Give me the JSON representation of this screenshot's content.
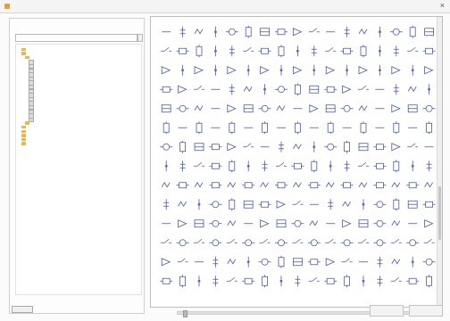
{
  "window": {
    "title": "",
    "close_glyph": "×",
    "icon": "app-icon"
  },
  "left_panel": {
    "filter_label": "",
    "filter_value": "",
    "tree": [
      {
        "indent": 1,
        "type": "folder",
        "label": ""
      },
      {
        "indent": 1,
        "type": "folder",
        "label": ""
      },
      {
        "indent": 2,
        "type": "folder",
        "label": "",
        "selected": true
      },
      {
        "indent": 3,
        "type": "file",
        "label": ""
      },
      {
        "indent": 3,
        "type": "file",
        "label": ""
      },
      {
        "indent": 3,
        "type": "file",
        "label": ""
      },
      {
        "indent": 3,
        "type": "file",
        "label": ""
      },
      {
        "indent": 3,
        "type": "file",
        "label": ""
      },
      {
        "indent": 3,
        "type": "file",
        "label": ""
      },
      {
        "indent": 3,
        "type": "file",
        "label": ""
      },
      {
        "indent": 3,
        "type": "file",
        "label": ""
      },
      {
        "indent": 3,
        "type": "file",
        "label": ""
      },
      {
        "indent": 3,
        "type": "file",
        "label": ""
      },
      {
        "indent": 3,
        "type": "file",
        "label": ""
      },
      {
        "indent": 3,
        "type": "file",
        "label": ""
      },
      {
        "indent": 3,
        "type": "file",
        "label": ""
      },
      {
        "indent": 3,
        "type": "file",
        "label": ""
      },
      {
        "indent": 3,
        "type": "file",
        "label": ""
      },
      {
        "indent": 2,
        "type": "folder",
        "label": ""
      },
      {
        "indent": 1,
        "type": "folder",
        "label": ""
      },
      {
        "indent": 1,
        "type": "folder",
        "label": ""
      },
      {
        "indent": 1,
        "type": "folder",
        "label": ""
      },
      {
        "indent": 1,
        "type": "folder",
        "label": ""
      },
      {
        "indent": 1,
        "type": "folder",
        "label": ""
      }
    ],
    "bottom_button": ""
  },
  "symbol_grid": {
    "rows": 14,
    "cols": 17,
    "color": "#4a5ba8"
  },
  "zoom": {
    "label": "",
    "level": 0.02
  },
  "footer": {
    "ok_label": "",
    "cancel_label": ""
  }
}
